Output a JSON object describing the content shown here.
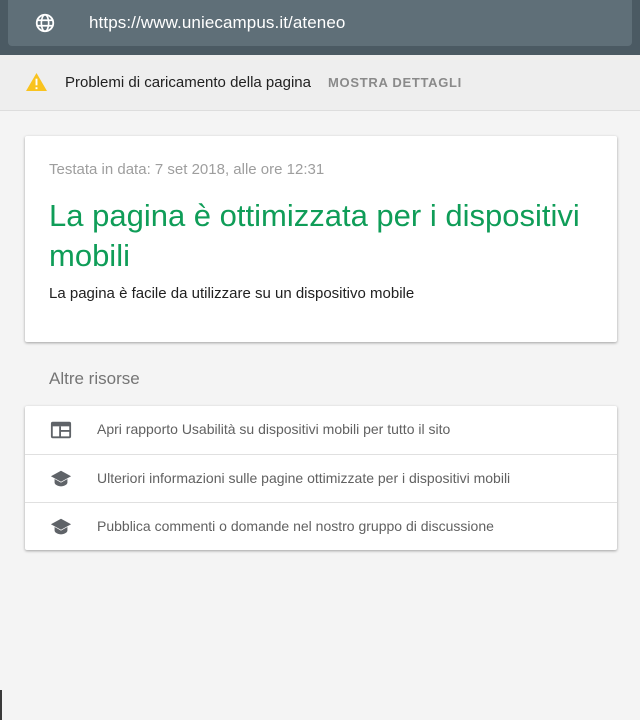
{
  "address_bar": {
    "url": "https://www.uniecampus.it/ateneo",
    "icon": "globe-icon"
  },
  "warning_bar": {
    "icon": "warning-icon",
    "icon_color": "#f9c31f",
    "message": "Problemi di caricamento della pagina",
    "action_label": "MOSTRA DETTAGLI"
  },
  "result": {
    "tested_on": "Testata in data: 7 set 2018, alle ore 12:31",
    "headline": "La pagina è ottimizzata per i dispositivi mobili",
    "headline_color": "#0f9d58",
    "description": "La pagina è facile da utilizzare su un dispositivo mobile"
  },
  "resources": {
    "title": "Altre risorse",
    "items": [
      {
        "icon": "web-report-icon",
        "label": "Apri rapporto Usabilità su dispositivi mobili per tutto il sito"
      },
      {
        "icon": "school-cap-icon",
        "label": "Ulteriori informazioni sulle pagine ottimizzate per i dispositivi mobili"
      },
      {
        "icon": "school-cap-icon",
        "label": "Pubblica commenti o domande nel nostro gruppo di discussione"
      }
    ]
  }
}
